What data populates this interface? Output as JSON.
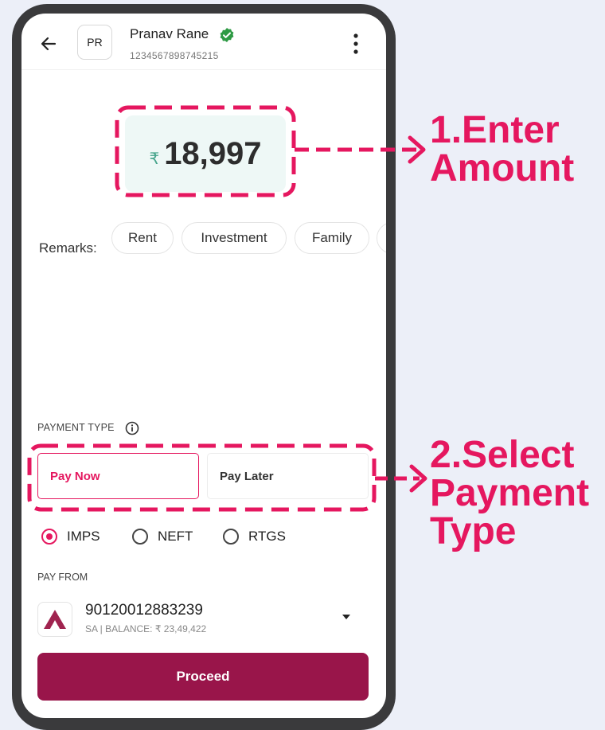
{
  "header": {
    "avatar_initials": "PR",
    "contact_name": "Pranav Rane",
    "account_number": "1234567898745215"
  },
  "amount": {
    "currency_symbol": "₹",
    "value": "18,997"
  },
  "remarks": {
    "label": "Remarks:",
    "chips": [
      "Rent",
      "Investment",
      "Family"
    ]
  },
  "payment_type": {
    "label": "PAYMENT TYPE",
    "options": [
      "Pay Now",
      "Pay Later"
    ],
    "selected": "Pay Now"
  },
  "transfer_modes": {
    "options": [
      "IMPS",
      "NEFT",
      "RTGS"
    ],
    "selected": "IMPS"
  },
  "pay_from": {
    "label": "PAY FROM",
    "account": "90120012883239",
    "balance_line": "SA | BALANCE: ₹ 23,49,422"
  },
  "proceed_label": "Proceed",
  "annotations": {
    "step1": [
      "1.Enter",
      "Amount"
    ],
    "step2": [
      "2.Select",
      "Payment",
      "Type"
    ]
  },
  "colors": {
    "accent": "#e5175f",
    "primary_button": "#99154a",
    "verified": "#2e9a44",
    "amount_bg": "#eef8f6",
    "phone_frame": "#3a3a3c",
    "background": "#eceff8"
  },
  "icons": [
    "back-arrow-icon",
    "verified-badge-icon",
    "more-vertical-icon",
    "info-icon",
    "bank-logo-icon",
    "dropdown-caret-icon"
  ]
}
